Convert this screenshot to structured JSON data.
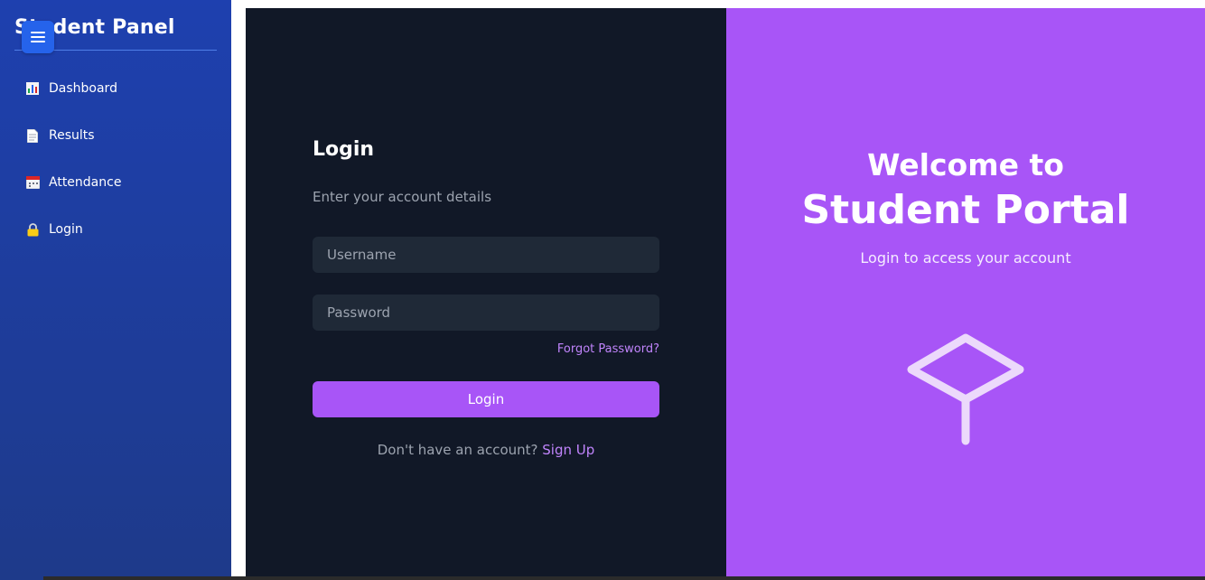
{
  "sidebar": {
    "title": "Student Panel",
    "items": [
      {
        "label": "Dashboard",
        "icon": "bar-chart-icon"
      },
      {
        "label": "Results",
        "icon": "document-icon"
      },
      {
        "label": "Attendance",
        "icon": "calendar-icon"
      },
      {
        "label": "Login",
        "icon": "lock-icon"
      }
    ]
  },
  "login": {
    "title": "Login",
    "subtitle": "Enter your account details",
    "username_placeholder": "Username",
    "password_placeholder": "Password",
    "forgot_label": "Forgot Password?",
    "button_label": "Login",
    "signup_prompt": "Don't have an account?",
    "signup_link": "Sign Up"
  },
  "welcome": {
    "line1": "Welcome to",
    "line2": "Student Portal",
    "subtitle": "Login to access your account",
    "icon": "graduation-cap-icon"
  },
  "colors": {
    "sidebar": "#1e40af",
    "login_bg": "#111827",
    "accent": "#a855f7",
    "input_bg": "#1f2937"
  }
}
